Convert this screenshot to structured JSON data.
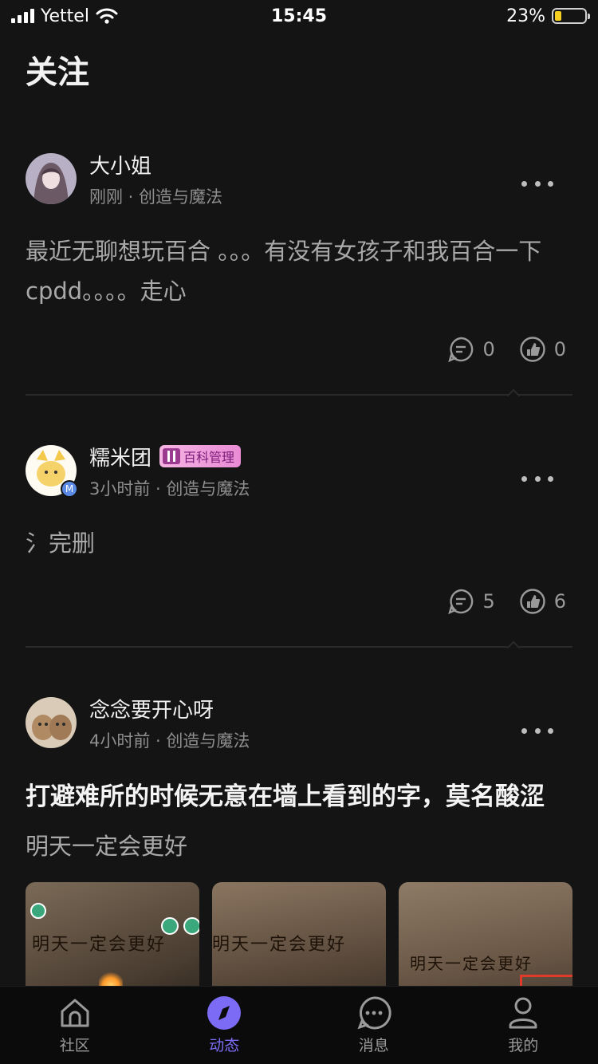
{
  "status_bar": {
    "carrier": "Yettel",
    "time": "15:45",
    "battery_text": "23%",
    "battery_level": 0.23
  },
  "header": {
    "title": "关注"
  },
  "posts": [
    {
      "author": "大小姐",
      "time": "刚刚",
      "category": "创造与魔法",
      "text": "最近无聊想玩百合 。。。有没有女孩子和我百合一下cpdd。。。。走心",
      "comments": "0",
      "likes": "0"
    },
    {
      "author": "糯米团",
      "badge": "百科管理",
      "avatar_badge": "M",
      "time": "3小时前",
      "category": "创造与魔法",
      "text": "氵完删",
      "comments": "5",
      "likes": "6"
    },
    {
      "author": "念念要开心呀",
      "time": "4小时前",
      "category": "创造与魔法",
      "title": "打避难所的时候无意在墙上看到的字，莫名酸涩",
      "text": "明天一定会更好",
      "image_caption": "明天一定会更好"
    }
  ],
  "meta_separator": " · ",
  "tabs": [
    {
      "label": "社区",
      "icon": "home-icon"
    },
    {
      "label": "动态",
      "icon": "compass-icon"
    },
    {
      "label": "消息",
      "icon": "chat-icon"
    },
    {
      "label": "我的",
      "icon": "profile-icon"
    }
  ],
  "colors": {
    "accent": "#7c6cf5",
    "background": "#141414",
    "badge": "#f6b5e3"
  }
}
